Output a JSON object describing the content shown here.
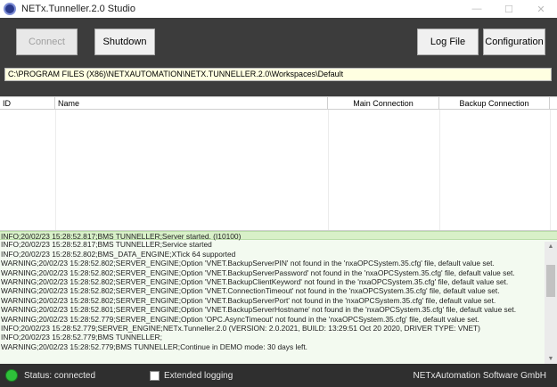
{
  "window": {
    "title": "NETx.Tunneller.2.0 Studio",
    "icons": [
      "app-icon",
      "minimize-icon",
      "maximize-icon",
      "close-icon"
    ]
  },
  "toolbar": {
    "connect_label": "Connect",
    "shutdown_label": "Shutdown",
    "logfile_label": "Log File",
    "configuration_label": "Configuration"
  },
  "workspace_path": "C:\\PROGRAM FILES (X86)\\NETXAUTOMATION\\NETX.TUNNELLER.2.0\\Workspaces\\Default",
  "table": {
    "columns": [
      "ID",
      "Name",
      "Main Connection",
      "Backup Connection"
    ],
    "rows": []
  },
  "log": [
    "INFO;20/02/23 15:28:52.817;BMS TUNNELLER;Server started. (I10100)",
    "INFO;20/02/23 15:28:52.817;BMS TUNNELLER;Service started",
    "INFO;20/02/23 15:28:52.802;BMS_DATA_ENGINE;XTick 64 supported",
    "WARNING;20/02/23 15:28:52.802;SERVER_ENGINE;Option 'VNET.BackupServerPIN' not found in the 'nxaOPCSystem.35.cfg' file, default value set.",
    "WARNING;20/02/23 15:28:52.802;SERVER_ENGINE;Option 'VNET.BackupServerPassword' not found in the 'nxaOPCSystem.35.cfg' file, default value set.",
    "WARNING;20/02/23 15:28:52.802;SERVER_ENGINE;Option 'VNET.BackupClientKeyword' not found in the 'nxaOPCSystem.35.cfg' file, default value set.",
    "WARNING;20/02/23 15:28:52.802;SERVER_ENGINE;Option 'VNET.ConnectionTimeout' not found in the 'nxaOPCSystem.35.cfg' file, default value set.",
    "WARNING;20/02/23 15:28:52.802;SERVER_ENGINE;Option 'VNET.BackupServerPort' not found in the 'nxaOPCSystem.35.cfg' file, default value set.",
    "WARNING;20/02/23 15:28:52.801;SERVER_ENGINE;Option 'VNET.BackupServerHostname' not found in the 'nxaOPCSystem.35.cfg' file, default value set.",
    "WARNING;20/02/23 15:28:52.779;SERVER_ENGINE;Option 'OPC.AsyncTimeout' not found in the 'nxaOPCSystem.35.cfg' file, default value set.",
    "INFO;20/02/23 15:28:52.779;SERVER_ENGINE;NETx.Tunneller.2.0 (VERSION: 2.0.2021, BUILD: 13:29:51 Oct 20 2020, DRIVER TYPE: VNET)",
    "INFO;20/02/23 15:28:52.779;BMS TUNNELLER;",
    "WARNING;20/02/23 15:28:52.779;BMS TUNNELLER;Continue in DEMO mode: 30 days left."
  ],
  "status": {
    "text": "Status: connected",
    "led_color": "#2ec03a",
    "extended_logging_label": "Extended logging",
    "extended_logging_checked": false,
    "company": "NETxAutomation Software GmbH"
  }
}
